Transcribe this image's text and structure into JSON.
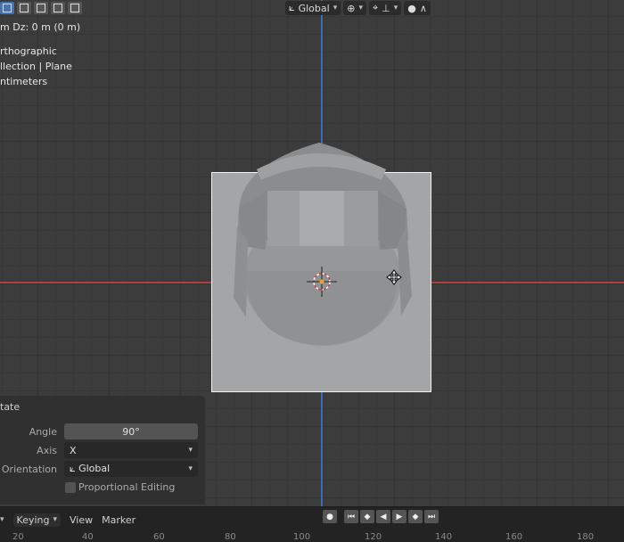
{
  "header": {
    "orientation_label": "Global",
    "orientation_icon": "transform-orientation-icon",
    "pivot_icon": "pivot-icon",
    "snap_icon": "snap-icon",
    "proportional_icon": "proportional-edit-icon"
  },
  "overlay": {
    "delta_line": "m  Dz: 0 m (0 m)",
    "view_name": "rthographic",
    "collection_line": "llection | Plane",
    "units_line": "ntimeters"
  },
  "operator_panel": {
    "title": "tate",
    "angle_label": "Angle",
    "angle_value": "90°",
    "axis_label": "Axis",
    "axis_value": "X",
    "orientation_label": "Orientation",
    "orientation_value": "Global",
    "proportional_label": "Proportional Editing"
  },
  "timeline": {
    "keying_label": "Keying",
    "view_label": "View",
    "marker_label": "Marker",
    "ruler_ticks": [
      "20",
      "40",
      "60",
      "80",
      "100",
      "120",
      "140",
      "160",
      "180"
    ]
  },
  "colors": {
    "x_axis": "#b0403f",
    "y_axis": "#3e6db8",
    "active_button": "#4772b3"
  }
}
